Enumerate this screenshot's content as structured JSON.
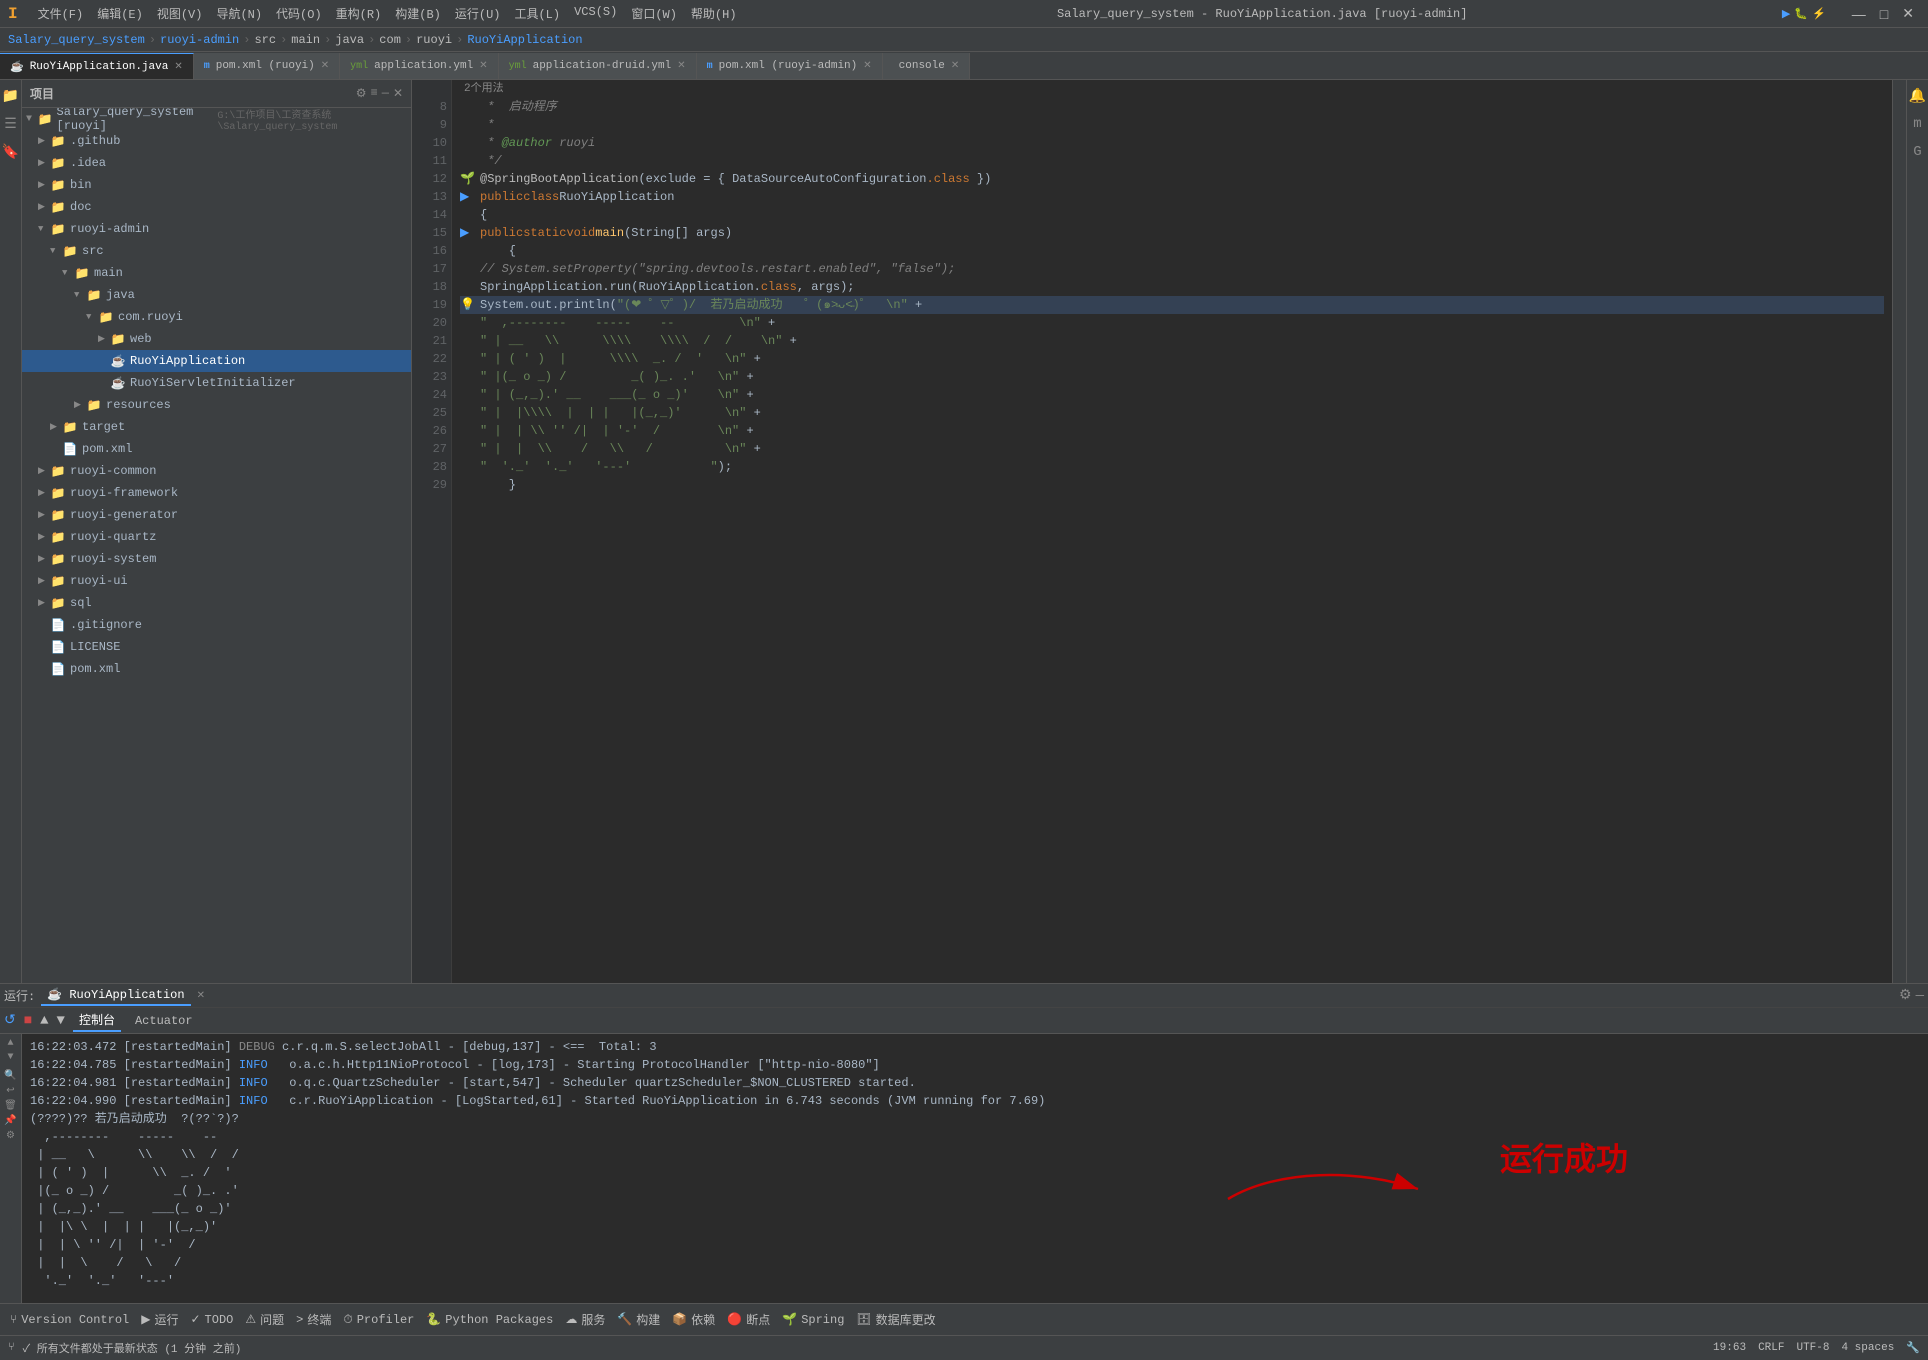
{
  "titlebar": {
    "logo": "I",
    "menus": [
      "文件(F)",
      "编辑(E)",
      "视图(V)",
      "导航(N)",
      "代码(O)",
      "重构(R)",
      "构建(B)",
      "运行(U)",
      "工具(L)",
      "VCS(S)",
      "窗口(W)",
      "帮助(H)"
    ],
    "title": "Salary_query_system - RuoYiApplication.java [ruoyi-admin]",
    "controls": [
      "—",
      "□",
      "✕"
    ]
  },
  "navbar": {
    "parts": [
      "Salary_query_system",
      "ruoyi-admin",
      "src",
      "main",
      "java",
      "com",
      "ruoyi",
      "RuoYiApplication"
    ]
  },
  "tabs": [
    {
      "label": "RuoYiApplication.java",
      "active": true,
      "icon": "☕"
    },
    {
      "label": "pom.xml (ruoyi)",
      "active": false,
      "icon": "m"
    },
    {
      "label": "application.yml",
      "active": false,
      "icon": "yml"
    },
    {
      "label": "application-druid.yml",
      "active": false,
      "icon": "yml"
    },
    {
      "label": "pom.xml (ruoyi-admin)",
      "active": false,
      "icon": "m"
    },
    {
      "label": "console",
      "active": false,
      "icon": ""
    }
  ],
  "project": {
    "header": "项目",
    "root": "Salary_query_system [ruoyi]",
    "root_path": "G:\\工作项目\\工资查系统\\Salary_query_system",
    "items": [
      {
        "id": "github",
        "label": ".github",
        "indent": 1,
        "type": "folder",
        "expanded": false
      },
      {
        "id": "idea",
        "label": ".idea",
        "indent": 1,
        "type": "folder",
        "expanded": false
      },
      {
        "id": "bin",
        "label": "bin",
        "indent": 1,
        "type": "folder",
        "expanded": false
      },
      {
        "id": "doc",
        "label": "doc",
        "indent": 1,
        "type": "folder",
        "expanded": false
      },
      {
        "id": "ruoyi-admin",
        "label": "ruoyi-admin",
        "indent": 1,
        "type": "folder",
        "expanded": true
      },
      {
        "id": "src",
        "label": "src",
        "indent": 2,
        "type": "folder",
        "expanded": true
      },
      {
        "id": "main",
        "label": "main",
        "indent": 3,
        "type": "folder",
        "expanded": true
      },
      {
        "id": "java",
        "label": "java",
        "indent": 4,
        "type": "folder",
        "expanded": true
      },
      {
        "id": "com.ruoyi",
        "label": "com.ruoyi",
        "indent": 5,
        "type": "package",
        "expanded": true
      },
      {
        "id": "web",
        "label": "web",
        "indent": 6,
        "type": "folder",
        "expanded": false
      },
      {
        "id": "RuoYiApplication",
        "label": "RuoYiApplication",
        "indent": 6,
        "type": "java",
        "expanded": false,
        "selected": true
      },
      {
        "id": "RuoYiServletInitializer",
        "label": "RuoYiServletInitializer",
        "indent": 6,
        "type": "java",
        "expanded": false
      },
      {
        "id": "resources",
        "label": "resources",
        "indent": 4,
        "type": "folder",
        "expanded": false
      },
      {
        "id": "target",
        "label": "target",
        "indent": 2,
        "type": "folder",
        "expanded": false
      },
      {
        "id": "pom-admin",
        "label": "pom.xml",
        "indent": 2,
        "type": "xml",
        "expanded": false
      },
      {
        "id": "ruoyi-common",
        "label": "ruoyi-common",
        "indent": 1,
        "type": "folder",
        "expanded": false
      },
      {
        "id": "ruoyi-framework",
        "label": "ruoyi-framework",
        "indent": 1,
        "type": "folder",
        "expanded": false
      },
      {
        "id": "ruoyi-generator",
        "label": "ruoyi-generator",
        "indent": 1,
        "type": "folder",
        "expanded": false
      },
      {
        "id": "ruoyi-quartz",
        "label": "ruoyi-quartz",
        "indent": 1,
        "type": "folder",
        "expanded": false
      },
      {
        "id": "ruoyi-system",
        "label": "ruoyi-system",
        "indent": 1,
        "type": "folder",
        "expanded": false
      },
      {
        "id": "ruoyi-ui",
        "label": "ruoyi-ui",
        "indent": 1,
        "type": "folder",
        "expanded": false
      },
      {
        "id": "sql",
        "label": "sql",
        "indent": 1,
        "type": "folder",
        "expanded": false
      },
      {
        "id": "gitignore",
        "label": ".gitignore",
        "indent": 1,
        "type": "file"
      },
      {
        "id": "LICENSE",
        "label": "LICENSE",
        "indent": 1,
        "type": "file"
      },
      {
        "id": "pom-root",
        "label": "pom.xml",
        "indent": 1,
        "type": "xml"
      }
    ]
  },
  "editor": {
    "lines": [
      {
        "num": 8,
        "content": " *  启动程序",
        "type": "comment"
      },
      {
        "num": 9,
        "content": " *",
        "type": "comment"
      },
      {
        "num": 10,
        "content": " * @author ruoyi",
        "type": "comment"
      },
      {
        "num": 11,
        "content": " */",
        "type": "comment"
      },
      {
        "num": 12,
        "content": "@SpringBootApplication(exclude = { DataSourceAutoConfiguration.class })",
        "type": "annotation"
      },
      {
        "num": 13,
        "content": "public class RuoYiApplication",
        "type": "code"
      },
      {
        "num": 14,
        "content": "{",
        "type": "code"
      },
      {
        "num": 15,
        "content": "    public static void main(String[] args)",
        "type": "code"
      },
      {
        "num": 16,
        "content": "    {",
        "type": "code"
      },
      {
        "num": 17,
        "content": "        // System.setProperty(\"spring.devtools.restart.enabled\", \"false\");",
        "type": "comment"
      },
      {
        "num": 18,
        "content": "        SpringApplication.run(RuoYiApplication.class, args);",
        "type": "code"
      },
      {
        "num": 19,
        "content": "        System.out.println(\"(❤ ゜▽゜)/  若乃启动成功   ゜(๑˃̵ᴗ˂̵)゜  \\n\" +",
        "type": "code"
      },
      {
        "num": 20,
        "content": "                \"  ,--------    -----    --         \\n\" +",
        "type": "string"
      },
      {
        "num": 21,
        "content": "                \" | __   \\\\      \\\\\\\\    \\\\\\\\  /  /    \\n\" +",
        "type": "string"
      },
      {
        "num": 22,
        "content": "                \" | ( ' )  |      \\\\\\\\  _. /  '   \\n\" +",
        "type": "string"
      },
      {
        "num": 23,
        "content": "                \" |(_ o _) /         _( )_. .'   \\n\" +",
        "type": "string"
      },
      {
        "num": 24,
        "content": "                \" | (_,_).' __    ___(_ o _)'    \\n\" +",
        "type": "string"
      },
      {
        "num": 25,
        "content": "                \" |  |\\\\ \\\\  |  | |   |(_,_)'      \\n\" +",
        "type": "string"
      },
      {
        "num": 26,
        "content": "                \" |  | \\\\ '' /|  | '-'  /        \\n\" +",
        "type": "string"
      },
      {
        "num": 27,
        "content": "                \" |  |  \\\\    /   \\\\   /          \\n\" +",
        "type": "string"
      },
      {
        "num": 28,
        "content": "                \"  '._'  '._'   '---'           \");",
        "type": "string"
      },
      {
        "num": 29,
        "content": "    }",
        "type": "code"
      }
    ],
    "hint": "2个用法"
  },
  "run_panel": {
    "title": "RuoYiApplication",
    "tabs": [
      "控制台",
      "Actuator"
    ],
    "logs": [
      "16:22:03.472 [restartedMain] DEBUG c.r.q.m.S.selectJobAll - [debug,137] - <==  Total: 3",
      "16:22:04.785 [restartedMain] INFO  o.a.c.h.Http11NioProtocol - [log,173] - Starting ProtocolHandler [\"http-nio-8080\"]",
      "16:22:04.981 [restartedMain] INFO  o.q.c.QuartzScheduler - [start,547] - Scheduler quartzScheduler_$NON_CLUSTERED started.",
      "16:22:04.990 [restartedMain] INFO  c.r.RuoYiApplication - [LogStarted,61] - Started RuoYiApplication in 6.743 seconds (JVM running for 7.69)",
      "(????)?? 若乃启动成功  ?(??`?)?"
    ],
    "ascii_art": [
      "  ,--------    -----    --",
      " | __   \\      \\\\    \\\\  /  /",
      " | ( ' )  |      \\\\  _. /  '",
      " |(_ o _) /         _( )_. .'",
      " | (_,_).' __    ___(_ o _)'",
      " |  |\\ \\  |  | |   |(_,_)'",
      " |  | \\ '' /|  | '-'  /",
      " |  |  \\    /   \\   /",
      "  '._'  '._'   '---'"
    ],
    "success_text": "运行成功"
  },
  "status_bar": {
    "left": "✓ 所有文件都处于最新状态 (1 分钟 之前)",
    "items": [
      "Version Control",
      "运行",
      "TODO",
      "问题",
      "终端",
      "Profiler",
      "Python Packages",
      "服务",
      "构建",
      "依赖",
      "断点",
      "Spring",
      "数据库更改"
    ],
    "right": {
      "line_col": "19:63",
      "encoding": "CRLF",
      "charset": "UTF-8",
      "indent": "4"
    }
  }
}
